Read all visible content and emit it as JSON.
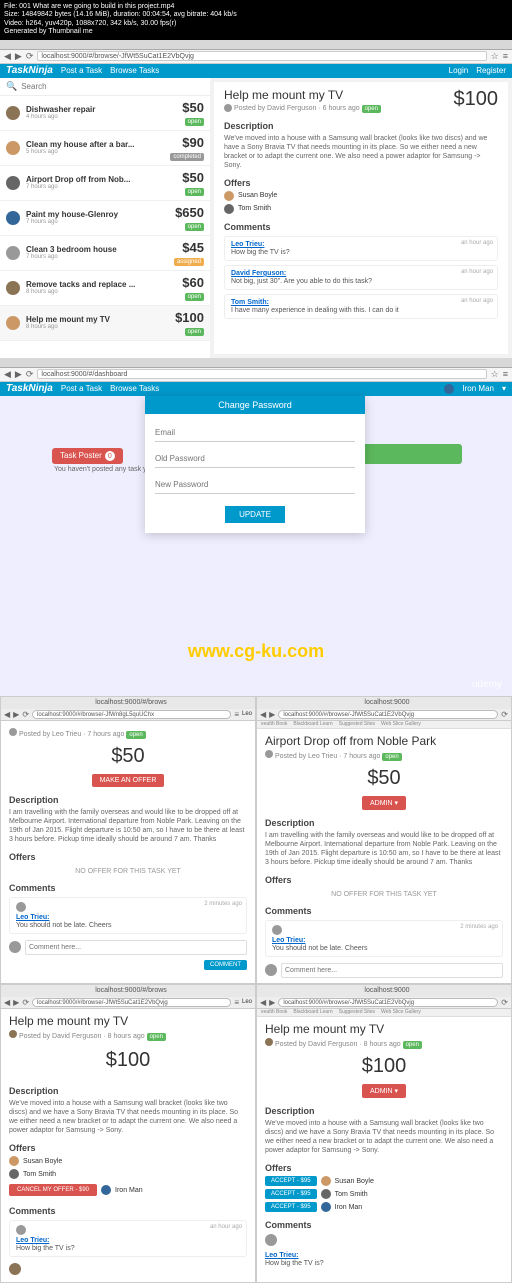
{
  "terminal": {
    "l1": "File: 001 What are we going to build in this project.mp4",
    "l2": "Size: 14849842 bytes (14.16 MiB), duration: 00:04:54, avg bitrate: 404 kb/s",
    "l3": "Video: h264, yuv420p, 1088x720, 342 kb/s, 30.00 fps(r)",
    "l4": "Generated by Thumbnail me"
  },
  "window1": {
    "url": "localhost:9000/#/browse/-JfWt5SuCat1E2VbQvjg",
    "brand": "TaskNinja",
    "nav_post": "Post a Task",
    "nav_browse": "Browse Tasks",
    "login": "Login",
    "register": "Register",
    "search_ph": "Search",
    "tasks": [
      {
        "t": "Dishwasher repair",
        "s": "4 hours ago",
        "p": "$50",
        "tag": "open",
        "tagc": "open"
      },
      {
        "t": "Clean my house after a bar...",
        "s": "5 hours ago",
        "p": "$90",
        "tag": "completed",
        "tagc": "completed"
      },
      {
        "t": "Airport Drop off from Nob...",
        "s": "7 hours ago",
        "p": "$50",
        "tag": "open",
        "tagc": "open"
      },
      {
        "t": "Paint my house-Glenroy",
        "s": "7 hours ago",
        "p": "$650",
        "tag": "open",
        "tagc": "open"
      },
      {
        "t": "Clean 3 bedroom house",
        "s": "7 hours ago",
        "p": "$45",
        "tag": "assigned",
        "tagc": "assigned"
      },
      {
        "t": "Remove tacks and replace ...",
        "s": "8 hours ago",
        "p": "$60",
        "tag": "open",
        "tagc": "open"
      },
      {
        "t": "Help me mount my TV",
        "s": "8 hours ago",
        "p": "$100",
        "tag": "open",
        "tagc": "open"
      }
    ],
    "detail": {
      "title": "Help me mount my TV",
      "price": "$100",
      "poster": "Posted by David Ferguson · 6 hours ago",
      "tag": "open",
      "desc_h": "Description",
      "desc": "We've moved into a house with a Samsung wall bracket (looks like two discs) and we have a Sony Bravia TV that needs mounting in its place. So we either need a new bracket or to adapt the current one. We also need a power adaptor for Samsung -> Sony.",
      "offers_h": "Offers",
      "offers": [
        {
          "n": "Susan Boyle"
        },
        {
          "n": "Tom Smith"
        }
      ],
      "comments_h": "Comments",
      "comments": [
        {
          "n": "Leo Trieu:",
          "b": "How big the TV is?",
          "t": "an hour ago"
        },
        {
          "n": "David Ferguson:",
          "b": "Not big, just 30\". Are you able to do this task?",
          "t": "an hour ago"
        },
        {
          "n": "Tom Smith:",
          "b": "I have many experience in dealing with this. I can do it",
          "t": "an hour ago"
        }
      ]
    }
  },
  "window2": {
    "url": "localhost:9000/#/dashboard",
    "brand": "TaskNinja",
    "nav_post": "Post a Task",
    "nav_browse": "Browse Tasks",
    "user": "Iron Man",
    "poster_label": "Task Poster",
    "poster_count": "0",
    "poster_msg": "You haven't posted any task yet.",
    "modal": {
      "title": "Change Password",
      "email": "Email",
      "old": "Old Password",
      "new": "New Password",
      "btn": "UPDATE"
    },
    "watermark": "www.cg-ku.com",
    "udemy": "udemy"
  },
  "c3": {
    "tab": "localhost:9000/#/brows",
    "url": "localhost:9000/#/browse/-JfWn8gL5quUChx",
    "poster": "Posted by Leo Trieu · 7 hours ago",
    "tag": "open",
    "price": "$50",
    "offer_btn": "MAKE AN OFFER",
    "desc_h": "Description",
    "desc": "I am travelling with the family overseas and would like to be dropped off at Melbourne Airport. International departure from Noble Park. Leaving on the 19th of Jan 2015. Flight departure is 10:50 am, so I have to be there at least 3 hours before. Pickup time ideally should be around 7 am. Thanks",
    "offers_h": "Offers",
    "no_off": "NO OFFER FOR THIS TASK YET",
    "comments_h": "Comments",
    "c_name": "Leo Trieu:",
    "c_body": "You should not be late. Cheers",
    "c_time": "2 minutes ago",
    "c_ph": "Comment here...",
    "c_btn": "COMMENT",
    "user": "Leo"
  },
  "c4": {
    "tab": "localhost:9000",
    "url": "localhost:9000/#/browse/-JfWt5SuCat1E2VbQvjg",
    "bookmarks": [
      "eealth Book",
      "Blackboard Learn",
      "Suggested Sites",
      "Web Slice Gallery"
    ],
    "title": "Airport Drop off from Noble Park",
    "poster": "Posted by Leo Trieu · 7 hours ago",
    "tag": "open",
    "price": "$50",
    "admin": "ADMIN",
    "desc_h": "Description",
    "desc": "I am travelling with the family overseas and would like to be dropped off at Melbourne Airport. International departure from Noble Park. Leaving on the 19th of Jan 2015. Flight departure is 10:50 am, so I have to be there at least 3 hours before. Pickup time ideally should be around 7 am. Thanks",
    "offers_h": "Offers",
    "no_off": "NO OFFER FOR THIS TASK YET",
    "comments_h": "Comments",
    "c_name": "Leo Trieu:",
    "c_body": "You should not be late. Cheers",
    "c_time": "2 minutes ago",
    "c_ph": "Comment here..."
  },
  "c5": {
    "tab": "localhost:9000/#/brows",
    "url": "localhost:9000/#/browse/-JfWt5SuCat1E2VbQvjg",
    "title": "Help me mount my TV",
    "poster": "Posted by David Ferguson · 8 hours ago",
    "tag": "open",
    "price": "$100",
    "desc_h": "Description",
    "desc": "We've moved into a house with a Samsung wall bracket (looks like two discs) and we have a Sony Bravia TV that needs mounting in its place. So we either need a new bracket or to adapt the current one. We also need a power adaptor for Samsung -> Sony.",
    "offers_h": "Offers",
    "off1": "Susan Boyle",
    "off2": "Tom Smith",
    "cancel": "CANCEL MY OFFER - $90",
    "me": "Iron Man",
    "comments_h": "Comments",
    "c_name": "Leo Trieu:",
    "c_body": "How big the TV is?",
    "c_time": "an hour ago",
    "user": "Leo"
  },
  "c6": {
    "tab": "localhost:9000",
    "url": "localhost:9000/#/browse/-JfWt5SuCat1E2VbQvjg",
    "bookmarks": [
      "eealth Book",
      "Blackboard Learn",
      "Suggested Sites",
      "Web Slice Gallery"
    ],
    "title": "Help me mount my TV",
    "poster": "Posted by David Ferguson · 8 hours ago",
    "tag": "open",
    "price": "$100",
    "admin": "ADMIN",
    "desc_h": "Description",
    "desc": "We've moved into a house with a Samsung wall bracket (looks like two discs) and we have a Sony Bravia TV that needs mounting in its place. So we either need a new bracket or to adapt the current one. We also need a power adaptor for Samsung -> Sony.",
    "offers_h": "Offers",
    "accept": "ACCEPT - $95",
    "o1": "Susan Boyle",
    "o2": "Tom Smith",
    "o3": "Iron Man",
    "comments_h": "Comments",
    "c_name": "Leo Trieu:",
    "c_body": "How big the TV is?"
  }
}
